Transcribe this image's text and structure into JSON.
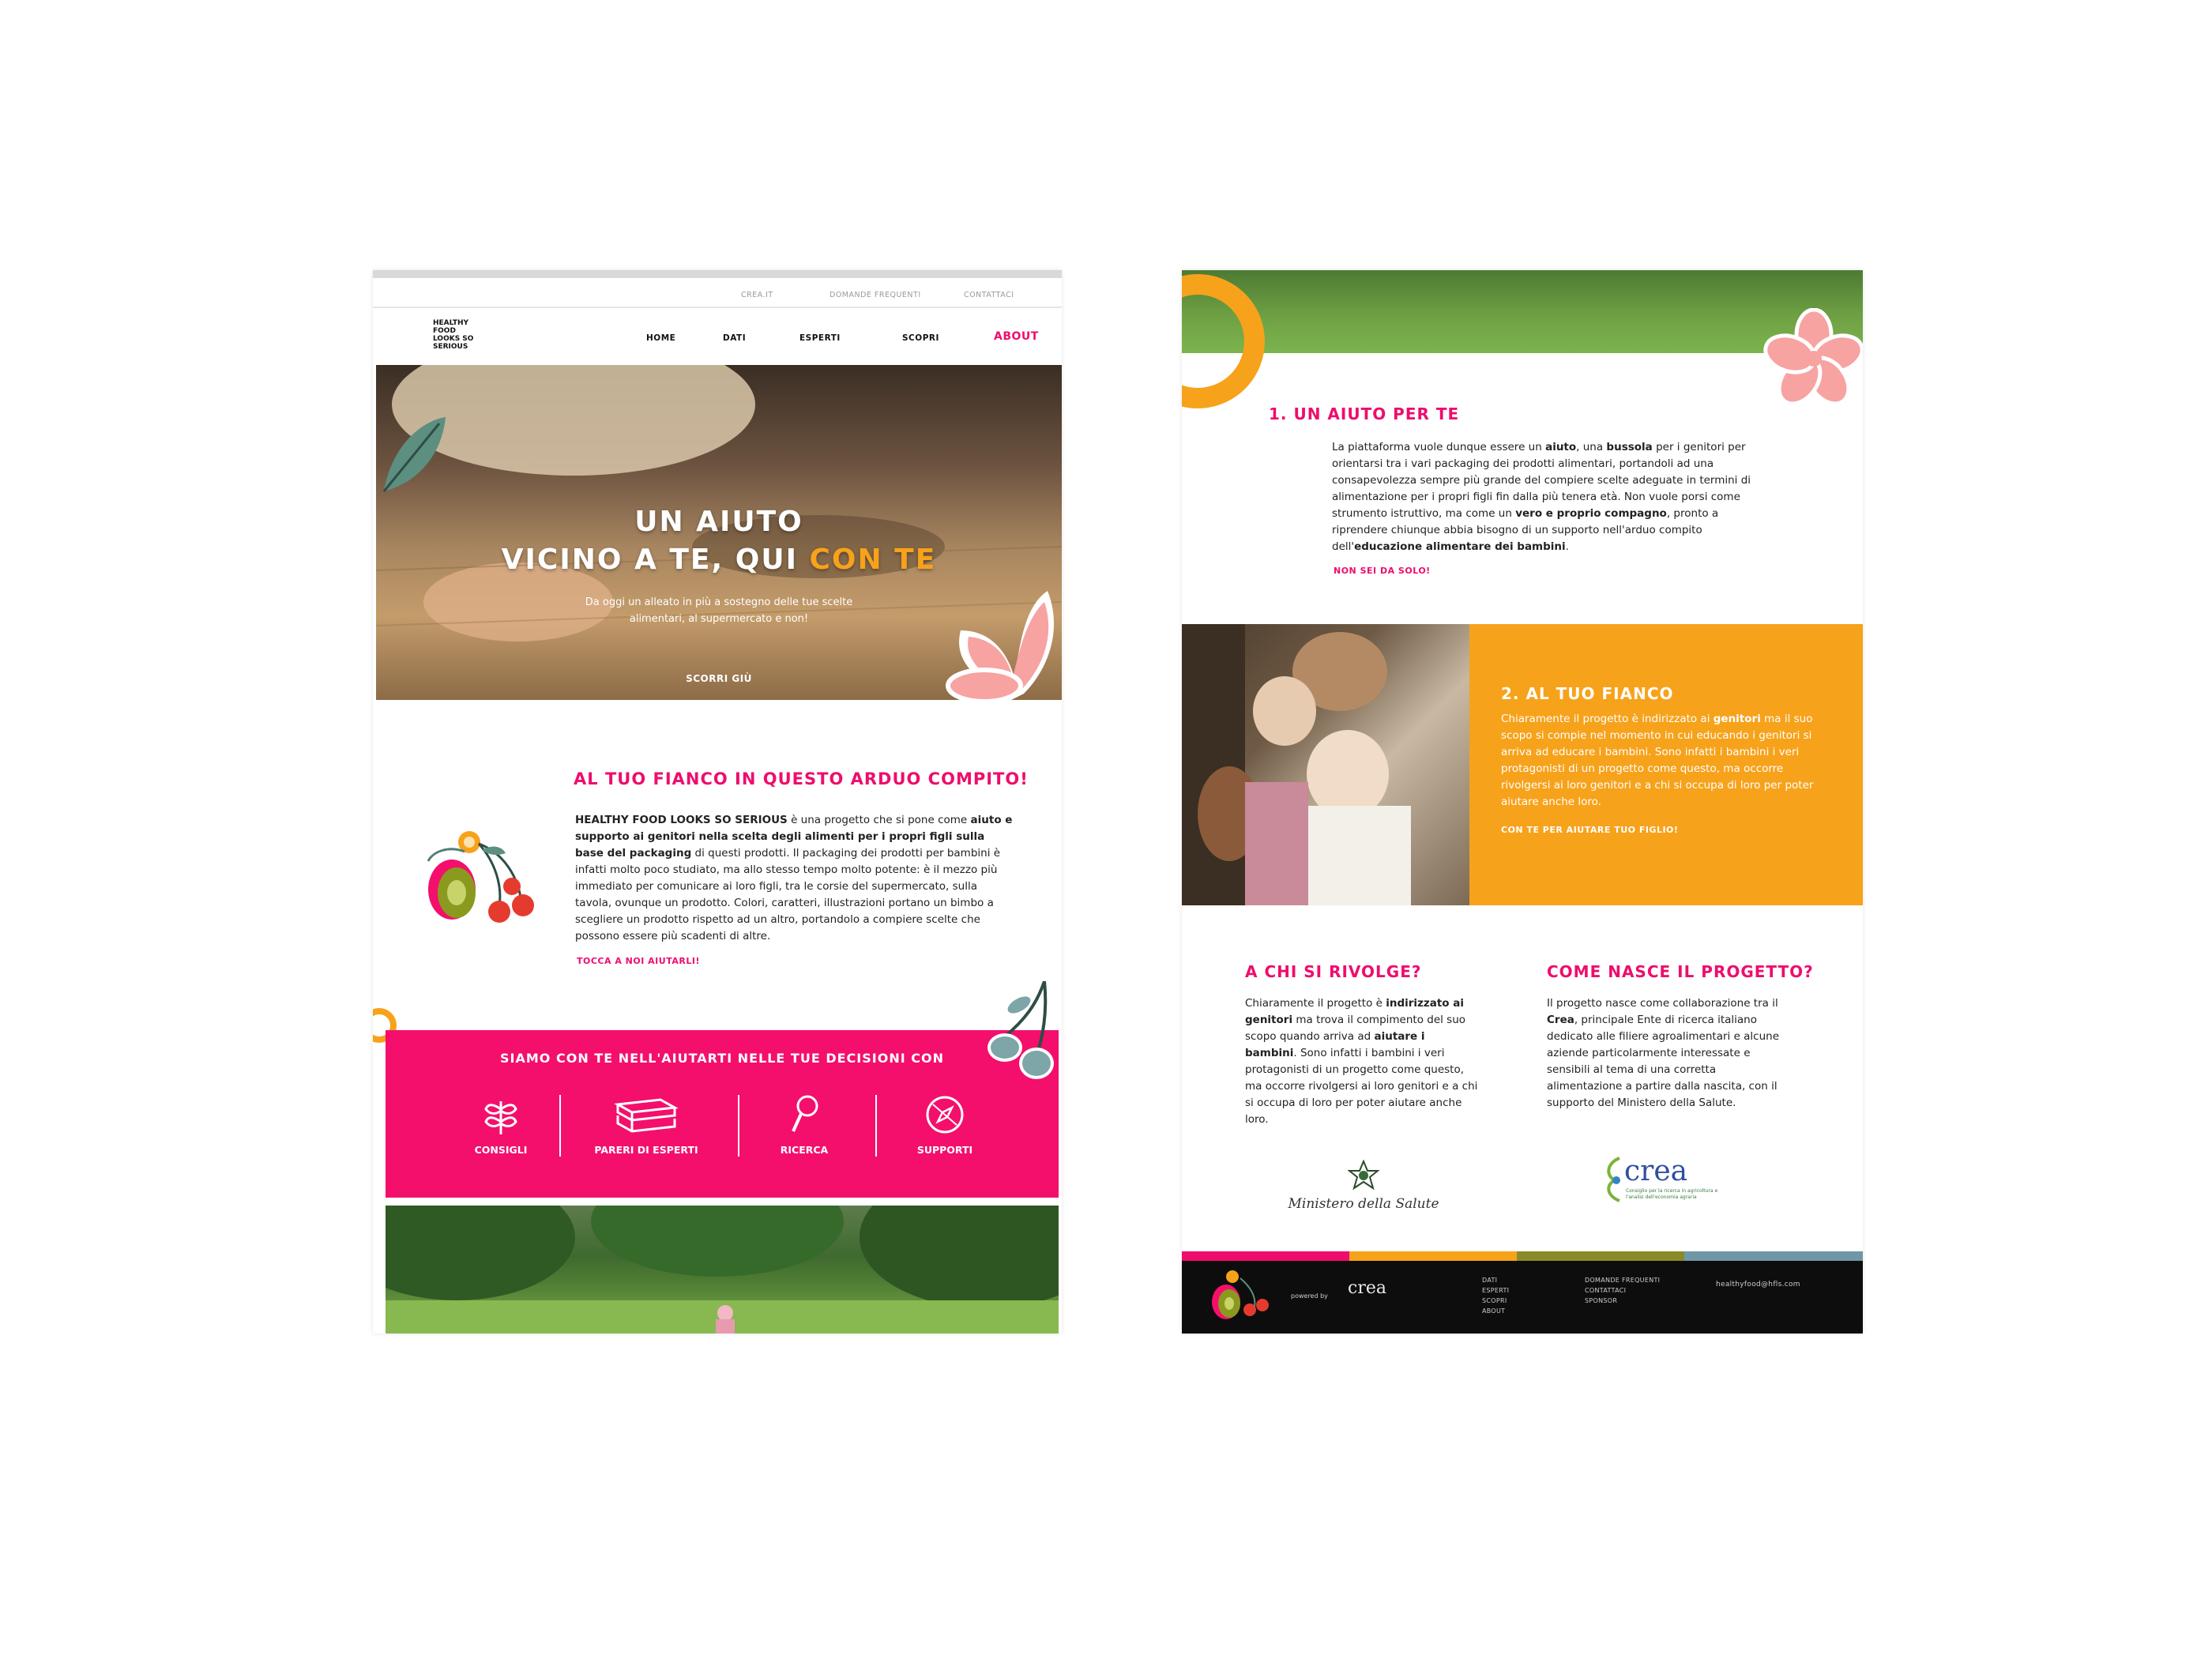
{
  "left_page": {
    "utility_nav": [
      "CREA.IT",
      "DOMANDE FREQUENTI",
      "CONTATTACI"
    ],
    "logo_lines": [
      "HEALTHY",
      "FOOD",
      "LOOKS SO",
      "SERIOUS"
    ],
    "main_nav": [
      "HOME",
      "DATI",
      "ESPERTI",
      "SCOPRI",
      "ABOUT"
    ],
    "hero": {
      "title_line1": "UN AIUTO",
      "title_line2_start": "VICINO A TE, QUI ",
      "title_line2_accent": "CON TE",
      "subtitle": "Da oggi un alleato in più a sostegno delle tue scelte alimentari, al supermercato e non!",
      "cta": "SCORRI GIÙ"
    },
    "intro": {
      "title": "AL TUO FIANCO IN QUESTO ARDUO COMPITO!",
      "brand": "HEALTHY FOOD LOOKS SO SERIOUS",
      "t1": " è una progetto che si pone come ",
      "b1": "aiuto e supporto ai genitori nella scelta degli alimenti per i propri figli sulla base del packaging",
      "t2": " di questi prodotti. Il packaging dei prodotti per bambini è infatti molto poco studiato, ma allo stesso tempo molto potente: è il mezzo più immediato per comunicare ai loro figli, tra le corsie del supermercato, sulla tavola, ovunque un prodotto. Colori, caratteri, illustrazioni portano un bimbo a scegliere un prodotto rispetto ad un altro, portandolo a compiere scelte che possono essere più scadenti di altre.",
      "link": "TOCCA A NOI AIUTARLI!"
    },
    "band": {
      "title": "SIAMO CON TE NELL'AIUTARTI NELLE TUE DECISIONI CON",
      "features": [
        "CONSIGLI",
        "PARERI DI ESPERTI",
        "RICERCA",
        "SUPPORTI"
      ]
    }
  },
  "right_page": {
    "section1": {
      "title": "1. UN AIUTO PER TE",
      "t1": "La piattaforma vuole dunque essere un ",
      "b1": "aiuto",
      "t2": ", una ",
      "b2": "bussola",
      "t3": " per i genitori per orientarsi tra i vari packaging dei prodotti alimentari, portandoli ad una consapevolezza sempre più grande del compiere scelte adeguate in termini di alimentazione per i propri figli fin dalla più tenera età. Non vuole porsi come strumento istruttivo, ma come un ",
      "b3": "vero e proprio compagno",
      "t4": ", pronto a riprendere chiunque abbia bisogno di un supporto nell'arduo compito dell'",
      "b4": "educazione alimentare dei bambini",
      "t5": ".",
      "link": "NON SEI DA SOLO!"
    },
    "section2": {
      "title": "2. AL TUO FIANCO",
      "t1": "Chiaramente il progetto è indirizzato ai ",
      "b1": "genitori",
      "t2": " ma il suo scopo si compie nel momento in cui educando i genitori si arriva ad educare i bambini. Sono infatti i bambini i veri protagonisti di un progetto come questo, ma occorre rivolgersi ai loro genitori e a chi si occupa di loro per poter aiutare anche loro.",
      "link": "CON TE PER AIUTARE TUO FIGLIO!"
    },
    "col_left": {
      "title": "A CHI SI RIVOLGE?",
      "t1": "Chiaramente il progetto è ",
      "b1": "indirizzato ai genitori",
      "t2": " ma trova il compimento del suo scopo quando arriva ad ",
      "b2": "aiutare i bambini",
      "t3": ". Sono infatti i bambini i veri protagonisti di un progetto come questo, ma occorre rivolgersi ai loro genitori e a chi si occupa di loro per poter aiutare anche loro.",
      "logo_text": "Ministero della Salute"
    },
    "col_right": {
      "title": "COME NASCE IL PROGETTO?",
      "t1": "Il progetto nasce come collaborazione tra il ",
      "b1": "Crea",
      "t2": ", principale Ente di ricerca italiano dedicato alle filiere agroalimentari e alcune aziende particolarmente interessate e sensibili al tema di una corretta alimentazione a partire dalla nascita, con il supporto del Ministero della Salute.",
      "logo_text": "crea",
      "logo_sub": "Consiglio per la ricerca in agricoltura e l'analisi dell'economia agraria"
    },
    "footer": {
      "powered_by": "powered by",
      "powered_logo": "crea",
      "col1": [
        "DATI",
        "ESPERTI",
        "SCOPRI",
        "ABOUT"
      ],
      "col2": [
        "DOMANDE FREQUENTI",
        "CONTATTACI",
        "SPONSOR"
      ],
      "email": "healthyfood@hfls.com"
    }
  },
  "colors": {
    "pink": "#ee0d6d",
    "orange": "#f7a21b",
    "olive": "#8a8a2a",
    "steel_blue": "#6f97a8",
    "footer": "#0d0d0d"
  }
}
